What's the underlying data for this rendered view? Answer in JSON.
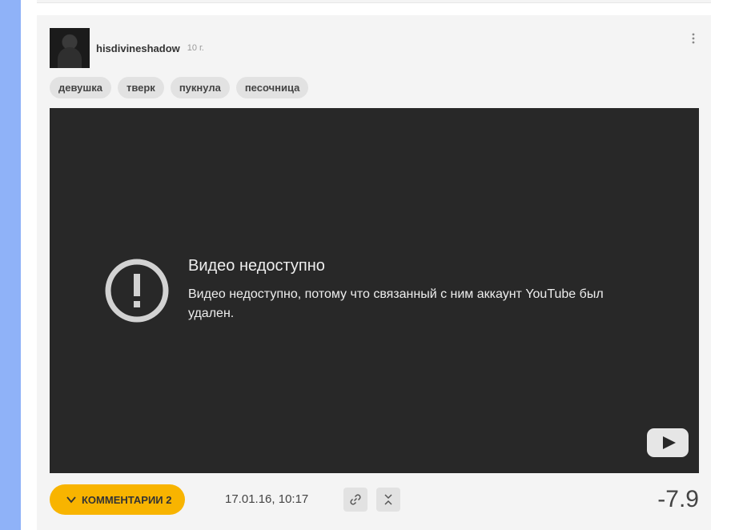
{
  "post": {
    "username": "hisdivineshadow",
    "age": "10 г.",
    "tags": [
      "девушка",
      "тверк",
      "пукнула",
      "песочница"
    ],
    "video": {
      "title": "Видео недоступно",
      "message": "Видео недоступно, потому что связанный с ним аккаунт YouTube был удален."
    },
    "footer": {
      "comments_label": "КОММЕНТАРИИ 2",
      "date": "17.01.16, 10:17",
      "rating": "-7.9"
    }
  },
  "colors": {
    "accent": "#f8b400",
    "sidebar": "#8fb2f8",
    "video_bg": "#282828"
  }
}
